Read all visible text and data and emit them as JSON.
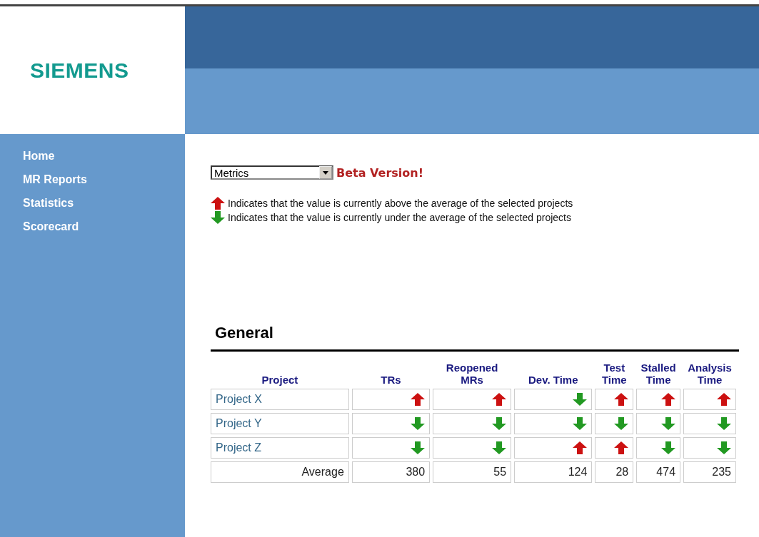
{
  "logo": "SIEMENS",
  "sidebar": {
    "items": [
      "Home",
      "MR Reports",
      "Statistics",
      "Scorecard"
    ]
  },
  "metric_select": {
    "value": "Metrics"
  },
  "beta_label": "Beta Version!",
  "legend": [
    {
      "above": true,
      "text": "Indicates that the value is currently above the average of the selected projects"
    },
    {
      "above": false,
      "text": "Indicates that the value is currently under the average of the selected projects"
    }
  ],
  "section_title": "General",
  "table": {
    "columns": [
      "Project",
      "TRs",
      "Reopened MRs",
      "Dev. Time",
      "Test Time",
      "Stalled Time",
      "Analysis Time"
    ],
    "rows": [
      {
        "project": "Project X",
        "cells": [
          {
            "above": true
          },
          {
            "above": true
          },
          {
            "above": false
          },
          {
            "above": true
          },
          {
            "above": true
          },
          {
            "above": true
          }
        ]
      },
      {
        "project": "Project Y",
        "cells": [
          {
            "above": false
          },
          {
            "above": false
          },
          {
            "above": false
          },
          {
            "above": false
          },
          {
            "above": false
          },
          {
            "above": false
          }
        ]
      },
      {
        "project": "Project Z",
        "cells": [
          {
            "above": false
          },
          {
            "above": false
          },
          {
            "above": true
          },
          {
            "above": true
          },
          {
            "above": false
          },
          {
            "above": false
          }
        ]
      }
    ],
    "average": {
      "label": "Average",
      "values": [
        "380",
        "55",
        "124",
        "28",
        "474",
        "235"
      ]
    }
  }
}
